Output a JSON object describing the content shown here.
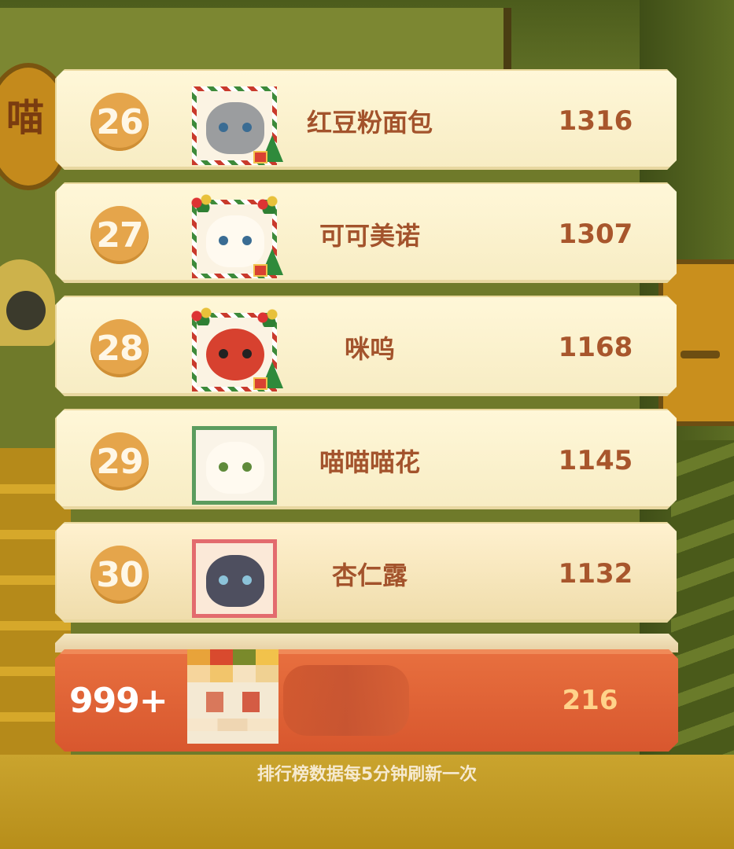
{
  "leaderboard": {
    "rows": [
      {
        "rank": "26",
        "name": "红豆粉面包",
        "score": "1316"
      },
      {
        "rank": "27",
        "name": "可可美诺",
        "score": "1307"
      },
      {
        "rank": "28",
        "name": "咪呜",
        "score": "1168"
      },
      {
        "rank": "29",
        "name": "喵喵喵花",
        "score": "1145"
      },
      {
        "rank": "30",
        "name": "杏仁露",
        "score": "1132"
      }
    ]
  },
  "my_rank": {
    "rank": "999+",
    "score": "216"
  },
  "footer_note": "排行榜数据每5分钟刷新一次",
  "background_sign": "喵",
  "colors": {
    "card_bg": "#fff7d8",
    "rank_badge": "#e5a54b",
    "text": "#a3532c",
    "my_bar": "#d8572e",
    "my_score": "#ffd38a"
  }
}
